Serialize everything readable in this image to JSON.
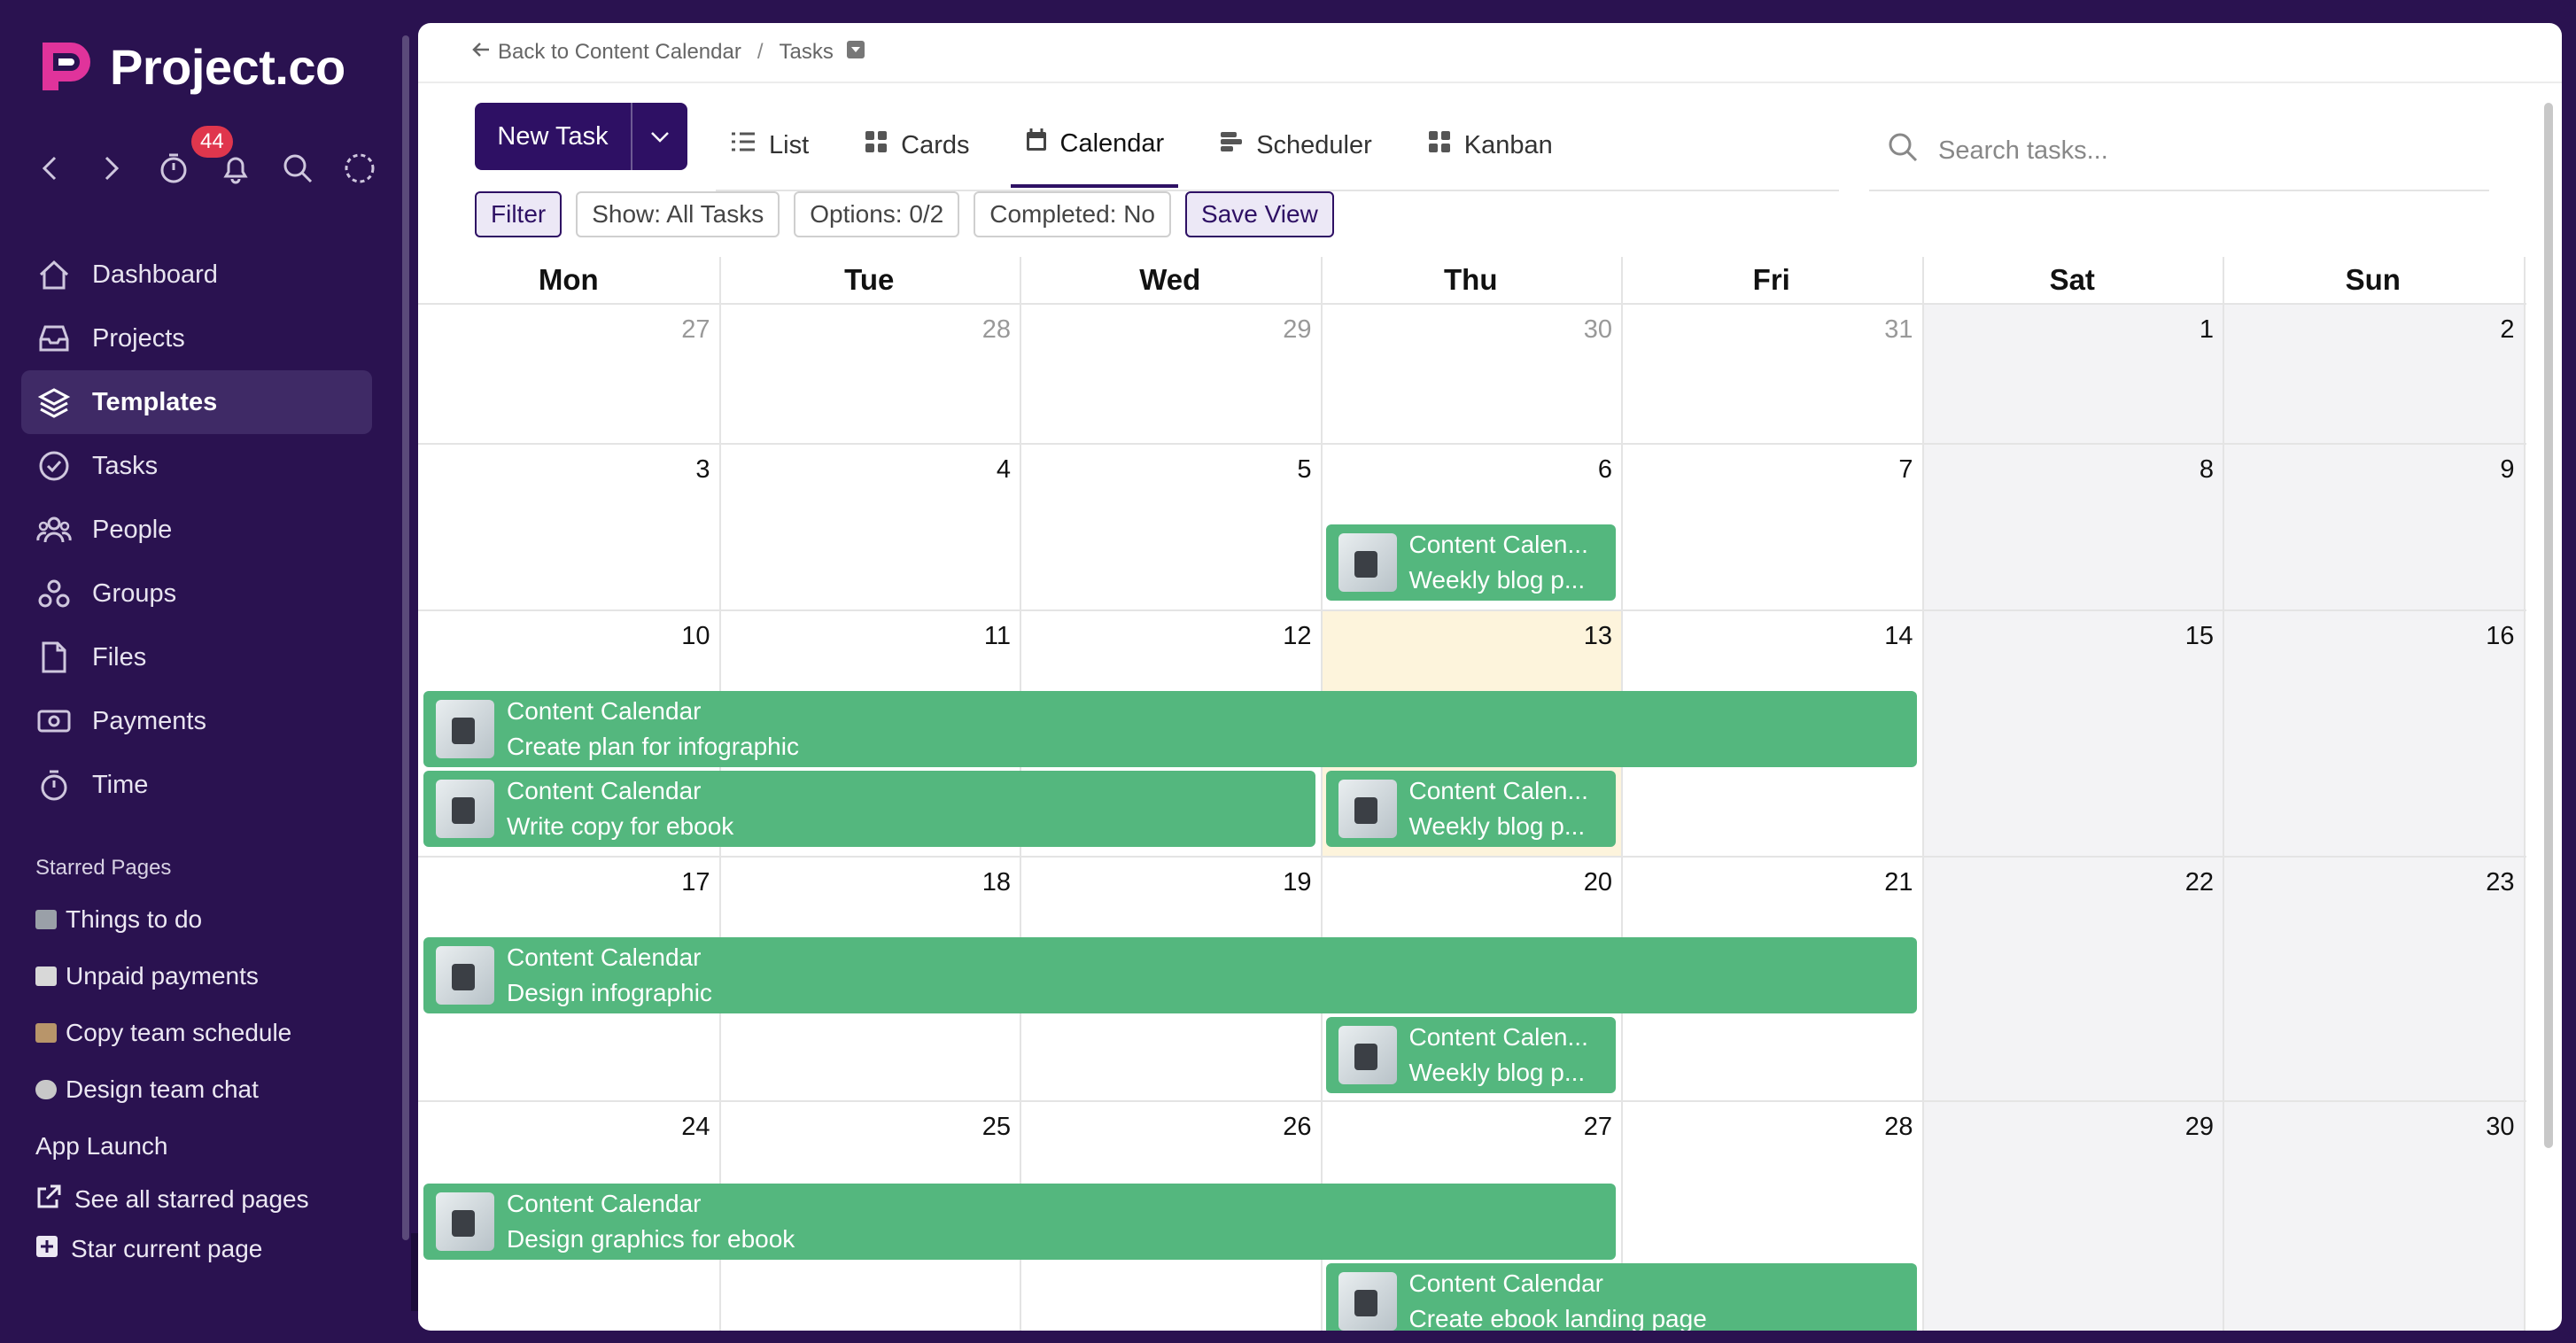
{
  "app": {
    "name": "Project.co",
    "notification_count": "44"
  },
  "sidebar": {
    "items": [
      {
        "label": "Dashboard",
        "icon": "home-icon"
      },
      {
        "label": "Projects",
        "icon": "inbox-icon"
      },
      {
        "label": "Templates",
        "icon": "layers-icon",
        "active": true
      },
      {
        "label": "Tasks",
        "icon": "check-circle-icon"
      },
      {
        "label": "People",
        "icon": "people-icon"
      },
      {
        "label": "Groups",
        "icon": "groups-icon"
      },
      {
        "label": "Files",
        "icon": "file-icon"
      },
      {
        "label": "Payments",
        "icon": "payments-icon"
      },
      {
        "label": "Time",
        "icon": "stopwatch-icon"
      }
    ],
    "starred_heading": "Starred Pages",
    "starred": [
      {
        "label": "Things to do",
        "color": "#9aa0a8"
      },
      {
        "label": "Unpaid payments",
        "color": "#d8d8d8"
      },
      {
        "label": "Copy team schedule",
        "color": "#b8956a"
      },
      {
        "label": "Design team chat",
        "color": "#c8c8c8"
      }
    ],
    "app_launch": "App Launch",
    "see_all": "See all starred pages",
    "star_current": "Star current page"
  },
  "breadcrumb": {
    "back": "Back to Content Calendar",
    "current": "Tasks"
  },
  "toolbar": {
    "new_task": "New Task",
    "search_placeholder": "Search tasks..."
  },
  "tabs": [
    {
      "label": "List",
      "icon": "list-icon"
    },
    {
      "label": "Cards",
      "icon": "cards-icon"
    },
    {
      "label": "Calendar",
      "icon": "calendar-icon",
      "active": true
    },
    {
      "label": "Scheduler",
      "icon": "scheduler-icon"
    },
    {
      "label": "Kanban",
      "icon": "kanban-icon"
    }
  ],
  "filters": [
    "Filter",
    "Show: All Tasks",
    "Options: 0/2",
    "Completed: No",
    "Save View"
  ],
  "calendar": {
    "days": [
      "Mon",
      "Tue",
      "Wed",
      "Thu",
      "Fri",
      "Sat",
      "Sun"
    ],
    "weeks": [
      [
        "27",
        "28",
        "29",
        "30",
        "31",
        "1",
        "2"
      ],
      [
        "3",
        "4",
        "5",
        "6",
        "7",
        "8",
        "9"
      ],
      [
        "10",
        "11",
        "12",
        "13",
        "14",
        "15",
        "16"
      ],
      [
        "17",
        "18",
        "19",
        "20",
        "21",
        "22",
        "23"
      ],
      [
        "24",
        "25",
        "26",
        "27",
        "28",
        "29",
        "30"
      ]
    ],
    "today": "13",
    "events": [
      {
        "line1": "Content Calen...",
        "line2": "Weekly blog p..."
      },
      {
        "line1": "Content Calendar",
        "line2": "Create plan for infographic"
      },
      {
        "line1": "Content Calendar",
        "line2": "Write copy for ebook"
      },
      {
        "line1": "Content Calen...",
        "line2": "Weekly blog p..."
      },
      {
        "line1": "Content Calendar",
        "line2": "Design infographic"
      },
      {
        "line1": "Content Calen...",
        "line2": "Weekly blog p..."
      },
      {
        "line1": "Content Calendar",
        "line2": "Design graphics for ebook"
      },
      {
        "line1": "Content Calendar",
        "line2": "Create ebook landing page"
      }
    ]
  }
}
